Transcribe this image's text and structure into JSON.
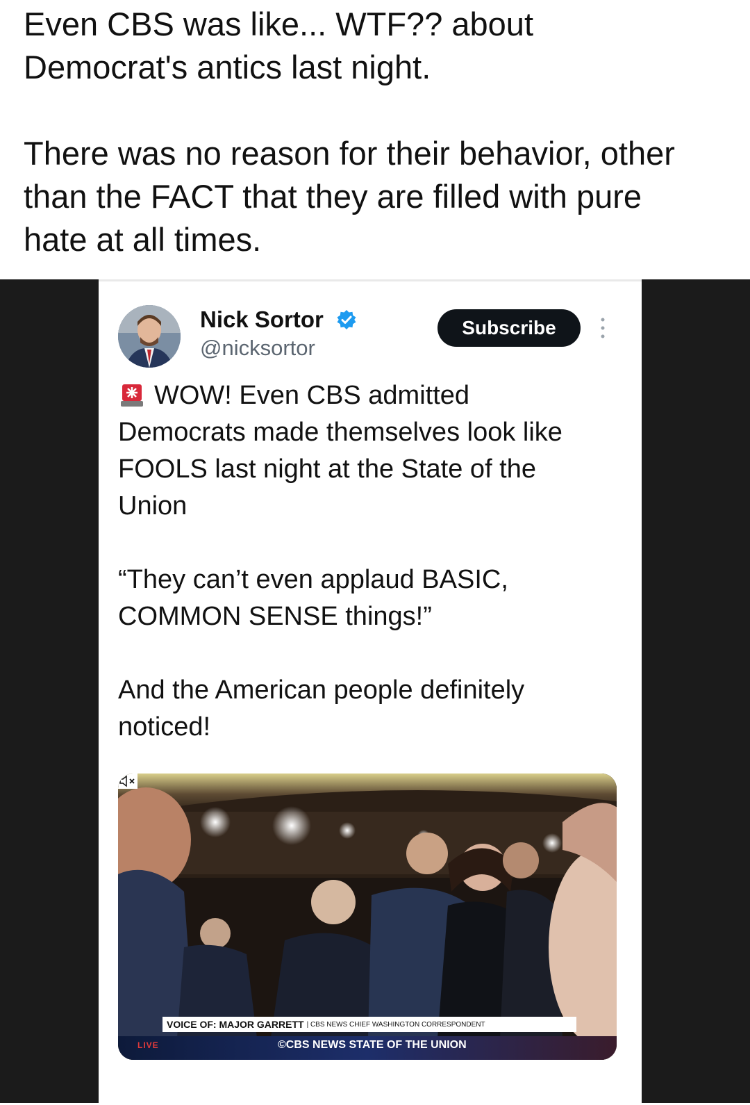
{
  "caption": {
    "line1": "Even CBS was like... WTF?? about",
    "line2": "Democrat's antics last night.",
    "line3": "There was no reason for their behavior, other",
    "line4": "than the FACT that they are filled with pure",
    "line5": "hate at all times."
  },
  "tweet": {
    "author_name": "Nick Sortor",
    "author_handle": "@nicksortor",
    "subscribe_label": "Subscribe",
    "paragraph1": {
      "line1": "WOW! Even CBS admitted",
      "line2": "Democrats made themselves look like",
      "line3": "FOOLS last night at the State of the",
      "line4": "Union"
    },
    "paragraph2": {
      "line1": "“They can’t even applaud BASIC,",
      "line2": "COMMON SENSE things!”"
    },
    "paragraph3": {
      "line1": "And the American people definitely",
      "line2": "noticed!"
    }
  },
  "video": {
    "voice_of": "VOICE OF: MAJOR GARRETT",
    "title_sub": "| CBS NEWS CHIEF WASHINGTON CORRESPONDENT",
    "live_label": "LIVE",
    "network_label": "©CBS NEWS STATE OF THE UNION"
  },
  "icons": {
    "verified": "verified-badge-icon",
    "more": "more-options-icon",
    "siren": "rotating-light-icon",
    "mute": "muted-speaker-icon"
  },
  "colors": {
    "subscribe_bg": "#0f1419",
    "verified_blue": "#1d9bf0",
    "dark_background": "#1b1b1b"
  }
}
